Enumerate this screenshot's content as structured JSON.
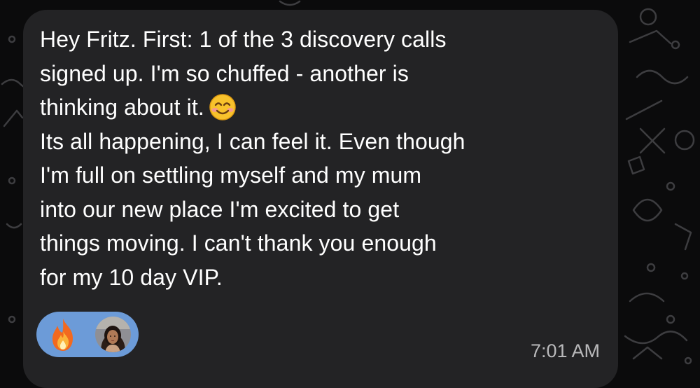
{
  "message": {
    "lines": [
      "Hey Fritz. First: 1 of the 3 discovery calls",
      "signed up. I'm so chuffed - another is",
      "thinking about it.",
      "Its all happening, I can feel it. Even though",
      "I'm full on settling myself and my mum",
      "into our new place I'm excited to get",
      "things moving. I can't thank you enough",
      "for my 10 day VIP."
    ],
    "timestamp": "7:01 AM",
    "inline_emoji": "smiling-face-icon"
  },
  "reaction": {
    "emoji": "fire-icon",
    "avatar": "avatar"
  },
  "colors": {
    "bubble": "#232325",
    "text": "#ffffff",
    "timestamp": "#b8b8ba",
    "reaction_pill": "#6c9bd8",
    "background": "#0b0b0c"
  }
}
